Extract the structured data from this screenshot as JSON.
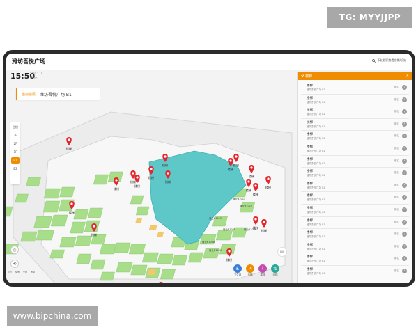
{
  "watermarks": {
    "tg": "TG: MYYJJPP",
    "web": "www.bipchina.com"
  },
  "header": {
    "title": "潍坊吾悦广场",
    "search_placeholder": "下拉搜索查看店铺/设施",
    "time": "15:50",
    "date": "2023-7-15",
    "weekday": "星期六"
  },
  "location": {
    "tag": "当前楼层",
    "name": "潍坊吾悦广场 B1"
  },
  "floors": {
    "items": [
      "主楼",
      "3F",
      "2F",
      "1F",
      "B1",
      "B2"
    ],
    "active": "B1"
  },
  "tools": [
    "定位",
    "缩放",
    "全屏",
    "收藏"
  ],
  "map": {
    "pins": [
      "楼梯",
      "楼梯",
      "楼梯",
      "楼梯",
      "楼梯",
      "楼梯",
      "楼梯",
      "楼梯",
      "楼梯",
      "楼梯",
      "楼梯",
      "楼梯",
      "楼梯",
      "楼梯",
      "楼梯",
      "楼梯",
      "楼梯",
      "楼梯",
      "楼梯"
    ],
    "shops": [
      "商业B1011",
      "商业B1012",
      "商业B1013",
      "商业B1005",
      "商业B1006",
      "商业B1008",
      "商业B1003"
    ]
  },
  "facilities": {
    "toilet": "卫生间",
    "lift": "扶梯",
    "stair": "楼梯",
    "elevator": "电梯",
    "route": "路线"
  },
  "panel": {
    "title": "楼梯",
    "close": "×",
    "go_label": "前往",
    "rows": [
      {
        "title": "楼梯",
        "sub": "潍坊吾悦广场 B1"
      },
      {
        "title": "楼梯",
        "sub": "潍坊吾悦广场 B1"
      },
      {
        "title": "扶梯",
        "sub": "潍坊吾悦广场 B1"
      },
      {
        "title": "扶梯",
        "sub": "潍坊吾悦广场 B1"
      },
      {
        "title": "楼梯",
        "sub": "潍坊吾悦广场 B1"
      },
      {
        "title": "楼梯",
        "sub": "潍坊吾悦广场 B1"
      },
      {
        "title": "楼梯",
        "sub": "潍坊吾悦广场 B1"
      },
      {
        "title": "楼梯",
        "sub": "潍坊吾悦广场 B1"
      },
      {
        "title": "楼梯",
        "sub": "潍坊吾悦广场 B1"
      },
      {
        "title": "楼梯",
        "sub": "潍坊吾悦广场 B1"
      },
      {
        "title": "楼梯",
        "sub": "潍坊吾悦广场 B1"
      },
      {
        "title": "楼梯",
        "sub": "潍坊吾悦广场 B1"
      },
      {
        "title": "楼梯",
        "sub": "潍坊吾悦广场 B1"
      },
      {
        "title": "楼梯",
        "sub": "潍坊吾悦广场 B1"
      },
      {
        "title": "楼梯",
        "sub": "潍坊吾悦广场 B1"
      },
      {
        "title": "楼梯",
        "sub": "潍坊吾悦广场 B1"
      }
    ]
  },
  "colors": {
    "accent": "#f08c00",
    "atrium": "#5ec8c8",
    "shop": "#a8dd8a",
    "pin": "#e0282e"
  }
}
